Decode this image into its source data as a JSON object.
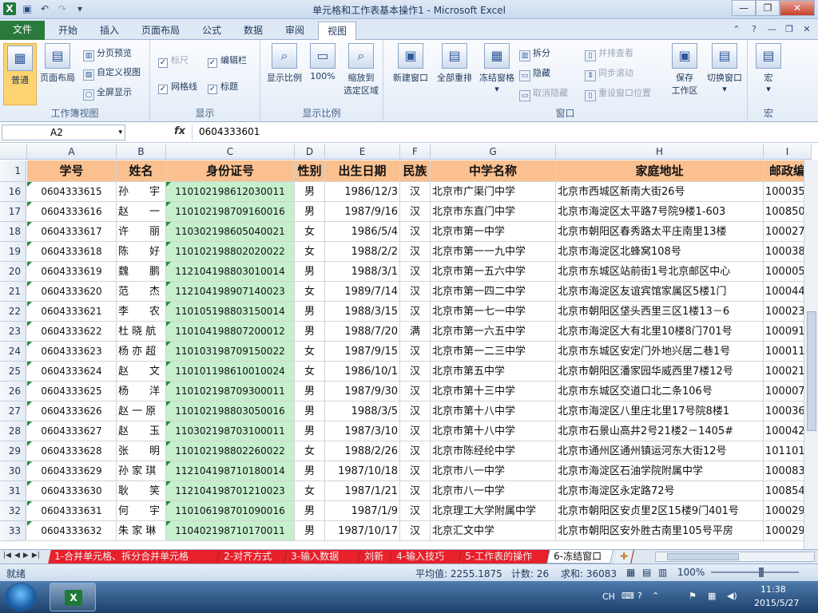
{
  "window": {
    "title": "单元格和工作表基本操作1 - Microsoft Excel"
  },
  "ribbon_tabs": [
    "文件",
    "开始",
    "插入",
    "页面布局",
    "公式",
    "数据",
    "审阅",
    "视图"
  ],
  "ribbon": {
    "workbook_views": {
      "label": "工作簿视图",
      "normal": "普通",
      "page_layout": "页面布局",
      "page_break": "分页预览",
      "custom": "自定义视图",
      "fullscreen": "全屏显示"
    },
    "show": {
      "label": "显示",
      "ruler": "标尺",
      "formula_bar": "编辑栏",
      "gridlines": "网格线",
      "headings": "标题"
    },
    "zoom": {
      "label": "显示比例",
      "zoom": "显示比例",
      "pct100": "100%",
      "zoom_sel_1": "缩放到",
      "zoom_sel_2": "选定区域"
    },
    "window": {
      "label": "窗口",
      "new_window": "新建窗口",
      "arrange_all": "全部重排",
      "freeze": "冻结窗格",
      "split": "拆分",
      "hide": "隐藏",
      "unhide": "取消隐藏",
      "side_by_side": "并排查看",
      "sync_scroll": "同步滚动",
      "reset_pos": "重设窗口位置",
      "save_ws_1": "保存",
      "save_ws_2": "工作区",
      "switch": "切换窗口"
    },
    "macro": {
      "label": "宏",
      "macro": "宏"
    }
  },
  "formula_bar": {
    "name_box": "A2",
    "fx": "fx",
    "value": "0604333601"
  },
  "columns": [
    "A",
    "B",
    "C",
    "D",
    "E",
    "F",
    "G",
    "H",
    "I"
  ],
  "header_row": {
    "row": "1",
    "cells": [
      "学号",
      "姓名",
      "身份证号",
      "性别",
      "出生日期",
      "民族",
      "中学名称",
      "家庭地址",
      "邮政编"
    ]
  },
  "rows": [
    {
      "row": "16",
      "cells": [
        "0604333615",
        "孙　　宇",
        "110102198612030011",
        "男",
        "1986/12/3",
        "汉",
        "北京市广渠门中学",
        "北京市西城区新南大街26号",
        "100035"
      ]
    },
    {
      "row": "17",
      "cells": [
        "0604333616",
        "赵　　一",
        "110102198709160016",
        "男",
        "1987/9/16",
        "汉",
        "北京市东直门中学",
        "北京市海淀区太平路7号院9楼1-603",
        "100850"
      ]
    },
    {
      "row": "18",
      "cells": [
        "0604333617",
        "许　　丽",
        "110302198605040021",
        "女",
        "1986/5/4",
        "汉",
        "北京市第一中学",
        "北京市朝阳区春秀路太平庄南里13楼",
        "100027"
      ]
    },
    {
      "row": "19",
      "cells": [
        "0604333618",
        "陈　　好",
        "110102198802020022",
        "女",
        "1988/2/2",
        "汉",
        "北京市第一一九中学",
        "北京市海淀区北蜂窝108号",
        "100038"
      ]
    },
    {
      "row": "20",
      "cells": [
        "0604333619",
        "魏　　鹏",
        "112104198803010014",
        "男",
        "1988/3/1",
        "汉",
        "北京市第一五六中学",
        "北京市东城区站前街1号北京邮区中心",
        "100005"
      ]
    },
    {
      "row": "21",
      "cells": [
        "0604333620",
        "范　　杰",
        "112104198907140023",
        "女",
        "1989/7/14",
        "汉",
        "北京市第一四二中学",
        "北京市海淀区友谊宾馆家属区5楼1门",
        "100044"
      ]
    },
    {
      "row": "22",
      "cells": [
        "0604333621",
        "李　　农",
        "110105198803150014",
        "男",
        "1988/3/15",
        "汉",
        "北京市第一七一中学",
        "北京市朝阳区垡头西里三区1楼13－6",
        "100023"
      ]
    },
    {
      "row": "23",
      "cells": [
        "0604333622",
        "杜 晓 航",
        "110104198807200012",
        "男",
        "1988/7/20",
        "满",
        "北京市第一六五中学",
        "北京市海淀区大有北里10楼8门701号",
        "100091"
      ]
    },
    {
      "row": "24",
      "cells": [
        "0604333623",
        "杨 亦 超",
        "110103198709150022",
        "女",
        "1987/9/15",
        "汉",
        "北京市第一二三中学",
        "北京市东城区安定门外地兴居二巷1号",
        "100011"
      ]
    },
    {
      "row": "25",
      "cells": [
        "0604333624",
        "赵　　文",
        "110101198610010024",
        "女",
        "1986/10/1",
        "汉",
        "北京市第五中学",
        "北京市朝阳区潘家园华威西里7楼12号",
        "100021"
      ]
    },
    {
      "row": "26",
      "cells": [
        "0604333625",
        "杨　　洋",
        "110102198709300011",
        "男",
        "1987/9/30",
        "汉",
        "北京市第十三中学",
        "北京市东城区交道口北二条106号",
        "100007"
      ]
    },
    {
      "row": "27",
      "cells": [
        "0604333626",
        "赵 一 原",
        "110102198803050016",
        "男",
        "1988/3/5",
        "汉",
        "北京市第十八中学",
        "北京市海淀区八里庄北里17号院8楼1",
        "100036"
      ]
    },
    {
      "row": "28",
      "cells": [
        "0604333627",
        "赵　　玉",
        "110302198703100011",
        "男",
        "1987/3/10",
        "汉",
        "北京市第十八中学",
        "北京市石景山高井2号21楼2－1405#",
        "100042"
      ]
    },
    {
      "row": "29",
      "cells": [
        "0604333628",
        "张　　明",
        "110102198802260022",
        "女",
        "1988/2/26",
        "汉",
        "北京市陈经纶中学",
        "北京市通州区通州镇运河东大街12号",
        "101101"
      ]
    },
    {
      "row": "30",
      "cells": [
        "0604333629",
        "孙 家 琪",
        "112104198710180014",
        "男",
        "1987/10/18",
        "汉",
        "北京市八一中学",
        "北京市海淀区石油学院附属中学",
        "100083"
      ]
    },
    {
      "row": "31",
      "cells": [
        "0604333630",
        "耿　　笑",
        "112104198701210023",
        "女",
        "1987/1/21",
        "汉",
        "北京市八一中学",
        "北京市海淀区永定路72号",
        "100854"
      ]
    },
    {
      "row": "32",
      "cells": [
        "0604333631",
        "何　　宇",
        "110106198701090016",
        "男",
        "1987/1/9",
        "汉",
        "北京理工大学附属中学",
        "北京市朝阳区安贞里2区15楼9门401号",
        "100029"
      ]
    },
    {
      "row": "33",
      "cells": [
        "0604333632",
        "朱 家 琳",
        "110402198710170011",
        "男",
        "1987/10/17",
        "汉",
        "北京汇文中学",
        "北京市朝阳区安外胜古南里105号平房",
        "100029"
      ]
    }
  ],
  "sheet_tabs": [
    "1-合并单元格、拆分合并单元格",
    "2-对齐方式",
    "3-输入数据",
    "刘新",
    "4-输入技巧",
    "5-工作表的操作",
    "6-冻结窗口"
  ],
  "status": {
    "ready": "就绪",
    "average": "平均值: 2255.1875",
    "count": "计数: 26",
    "sum": "求和: 36083",
    "zoom": "100%"
  },
  "taskbar": {
    "lang": "CH",
    "time": "11:38",
    "date": "2015/5/27"
  },
  "colors": {
    "header_fill": "#fac090",
    "id_fill": "#c6efce",
    "sheet_tab": "#e8202a",
    "file_tab": "#2a7a3c"
  }
}
